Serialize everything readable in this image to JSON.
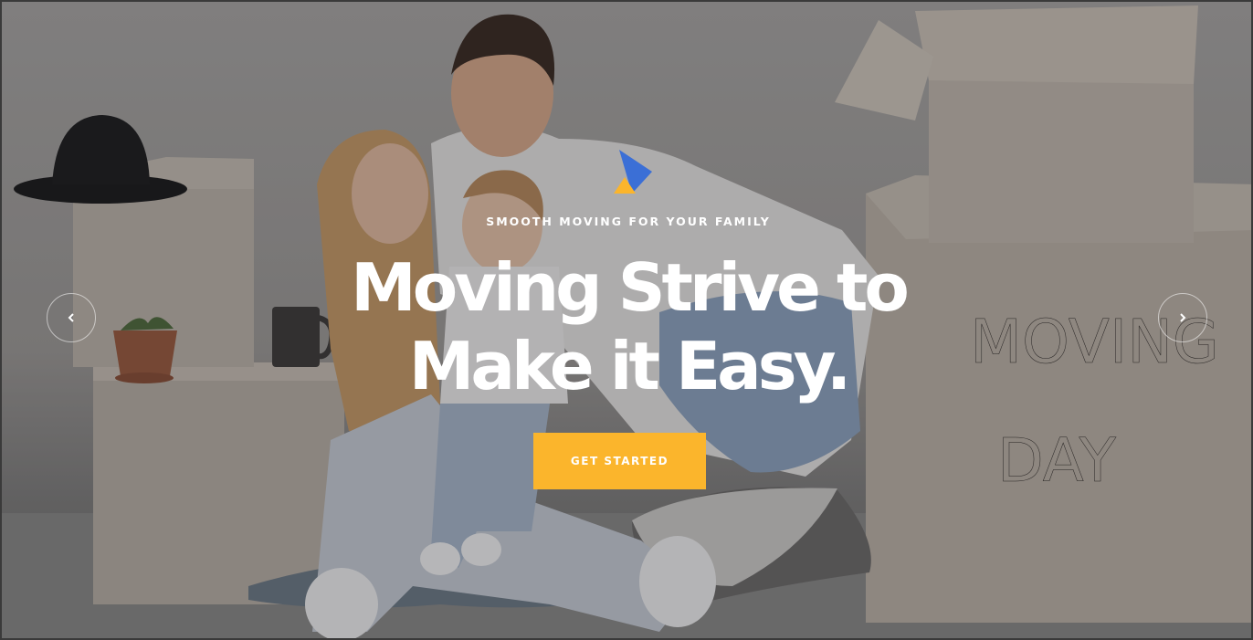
{
  "hero": {
    "subtitle": "SMOOTH MOVING FOR YOUR FAMILY",
    "headline_line1": "Moving Strive to",
    "headline_line2": "Make it Easy.",
    "cta_label": "GET STARTED",
    "box_writing_line1": "MOVING",
    "box_writing_line2": "DAY"
  },
  "colors": {
    "accent": "#fbb52c",
    "logo_blue": "#3b6fd6",
    "logo_yellow": "#fbb52c",
    "text": "#ffffff"
  },
  "icons": {
    "prev": "chevron-left-icon",
    "next": "chevron-right-icon",
    "logo": "logo-mark-icon"
  }
}
